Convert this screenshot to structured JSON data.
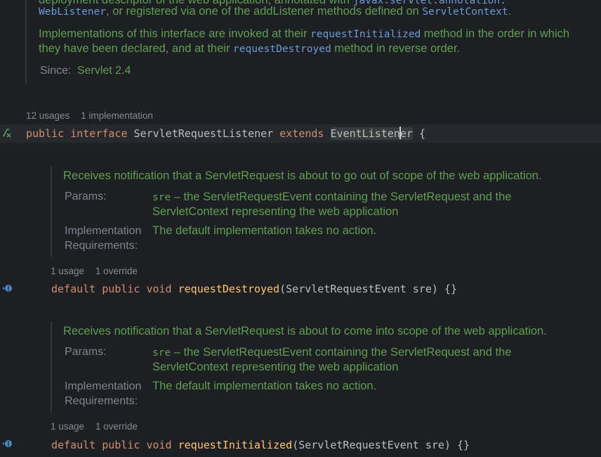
{
  "top_doc": {
    "line0_prefix": "deployment descriptor of the web application, annotated with ",
    "line0_code": "javax.servlet.annotation.",
    "line1_code": "WebListener",
    "line1_text": ", or registered via one of the addListener methods defined on ",
    "line1_code2": "ServletContext",
    "line1_end": ".",
    "line2_a": "Implementations of this interface are invoked at their ",
    "line2_code": "requestInitialized",
    "line2_b": " method in the order in which",
    "line3_a": "they have been declared, and at their ",
    "line3_code": "requestDestroyed",
    "line3_b": " method in reverse order.",
    "since_label": "Since:",
    "since_value": "Servlet 2.4"
  },
  "interface_hints": {
    "usages": "12 usages",
    "implementations": "1 implementation"
  },
  "interface_decl": {
    "kw_public": "public",
    "kw_interface": "interface",
    "name": "ServletRequestListener",
    "kw_extends": "extends",
    "parent_a": "EventListen",
    "parent_b": "er",
    "brace": "{"
  },
  "method1": {
    "doc_summary": "Receives notification that a ServletRequest is about to go out of scope of the web application.",
    "params_label": "Params:",
    "param_name": "sre",
    "param_desc1": " – the ServletRequestEvent containing the ServletRequest and the",
    "param_desc2": "ServletContext representing the web application",
    "impl_label1": "Implementation",
    "impl_label2": "Requirements:",
    "impl_value": "The default implementation takes no action.",
    "usage_hint": "1 usage",
    "override_hint": "1 override",
    "kw_default": "default",
    "kw_public": "public",
    "kw_void": "void",
    "name": "requestDestroyed",
    "signature": "(ServletRequestEvent sre) {}"
  },
  "method2": {
    "doc_summary": "Receives notification that a ServletRequest is about to come into scope of the web application.",
    "params_label": "Params:",
    "param_name": "sre",
    "param_desc1": " – the ServletRequestEvent containing the ServletRequest and the",
    "param_desc2": "ServletContext representing the web application",
    "impl_label1": "Implementation",
    "impl_label2": "Requirements:",
    "impl_value": "The default implementation takes no action.",
    "usage_hint": "1 usage",
    "override_hint": "1 override",
    "kw_default": "default",
    "kw_public": "public",
    "kw_void": "void",
    "name": "requestInitialized",
    "signature": "(ServletRequestEvent sre) {}"
  },
  "colors": {
    "background": "#1e1f22",
    "doc_text": "#5f9e53",
    "keyword": "#cf8e6d",
    "method": "#ffc66d",
    "doc_link": "#6b9bd8"
  },
  "icons": {
    "interface_gutter": "implemented-lambda-icon",
    "method_gutter": "overridden-method-icon"
  }
}
